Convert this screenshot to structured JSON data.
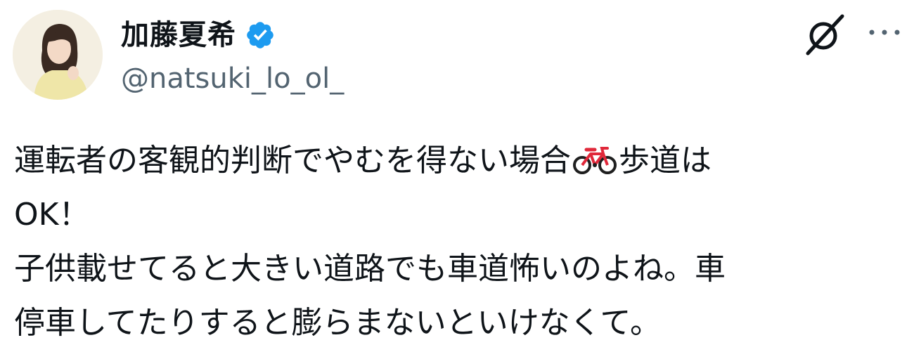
{
  "author": {
    "display_name": "加藤夏希",
    "handle": "@natsuki_lo_ol_",
    "avatar_icon": "user-avatar",
    "verified_icon": "verified-badge-icon"
  },
  "header_actions": {
    "grok_icon": "grok-icon",
    "more_icon": "more-horizontal-icon"
  },
  "tweet": {
    "line1_before_emoji": "運転者の客観的判断でやむを得ない場合",
    "emoji": "bicycle-icon",
    "line1_after_emoji": "歩道は",
    "line2": "OK！",
    "line3": "子供載せてると大きい道路でも車道怖いのよね。車",
    "line4": "停車してたりすると膨らまないといけなくて。"
  },
  "colors": {
    "text": "#0f1419",
    "secondary_text": "#536471",
    "verified_blue": "#1d9bf0",
    "bike_red": "#e0283a"
  }
}
